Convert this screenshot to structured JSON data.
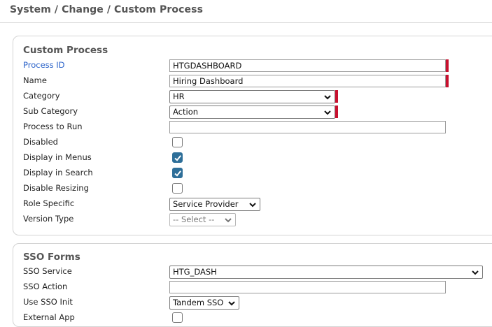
{
  "breadcrumb": "System / Change / Custom Process",
  "custom_process": {
    "title": "Custom Process",
    "fields": {
      "process_id": {
        "label": "Process ID",
        "value": "HTGDASHBOARD"
      },
      "name": {
        "label": "Name",
        "value": "Hiring Dashboard"
      },
      "category": {
        "label": "Category",
        "value": "HR"
      },
      "sub_category": {
        "label": "Sub Category",
        "value": "Action"
      },
      "process_to_run": {
        "label": "Process to Run",
        "value": ""
      },
      "disabled": {
        "label": "Disabled",
        "checked": false
      },
      "display_in_menus": {
        "label": "Display in Menus",
        "checked": true
      },
      "display_in_search": {
        "label": "Display in Search",
        "checked": true
      },
      "disable_resizing": {
        "label": "Disable Resizing",
        "checked": false
      },
      "role_specific": {
        "label": "Role Specific",
        "value": "Service Provider"
      },
      "version_type": {
        "label": "Version Type",
        "value": "-- Select --"
      }
    }
  },
  "sso_forms": {
    "title": "SSO Forms",
    "fields": {
      "sso_service": {
        "label": "SSO Service",
        "value": "HTG_DASH"
      },
      "sso_action": {
        "label": "SSO Action",
        "value": ""
      },
      "use_sso_init": {
        "label": "Use SSO Init",
        "value": "Tandem SSO"
      },
      "external_app": {
        "label": "External App",
        "checked": false
      }
    }
  },
  "colors": {
    "required_marker": "#c8102e",
    "checkbox_checked": "#2e6f99",
    "link_label": "#2a62c9"
  },
  "icons": {
    "dropdown": "chevron-down-icon",
    "check": "check-icon"
  }
}
